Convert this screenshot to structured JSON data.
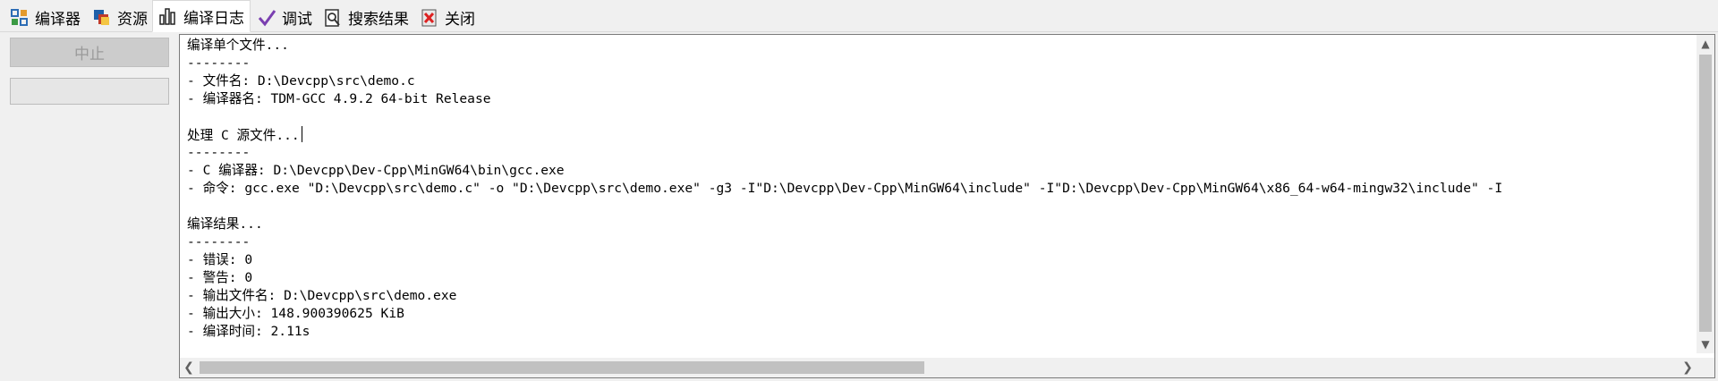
{
  "tabs": [
    {
      "label": "编译器",
      "icon": "grid-icon",
      "active": false
    },
    {
      "label": "资源",
      "icon": "resources-icon",
      "active": false
    },
    {
      "label": "编译日志",
      "icon": "bar-chart-icon",
      "active": true
    },
    {
      "label": "调试",
      "icon": "check-icon",
      "active": false
    },
    {
      "label": "搜索结果",
      "icon": "search-document-icon",
      "active": false
    },
    {
      "label": "关闭",
      "icon": "close-icon",
      "active": false
    }
  ],
  "left_panel": {
    "abort_label": "中止",
    "progress_value": 0
  },
  "log": {
    "lines": [
      "编译单个文件...",
      "--------",
      "- 文件名: D:\\Devcpp\\src\\demo.c",
      "- 编译器名: TDM-GCC 4.9.2 64-bit Release",
      "",
      "处理 C 源文件...",
      "--------",
      "- C 编译器: D:\\Devcpp\\Dev-Cpp\\MinGW64\\bin\\gcc.exe",
      "- 命令: gcc.exe \"D:\\Devcpp\\src\\demo.c\" -o \"D:\\Devcpp\\src\\demo.exe\" -g3 -I\"D:\\Devcpp\\Dev-Cpp\\MinGW64\\include\" -I\"D:\\Devcpp\\Dev-Cpp\\MinGW64\\x86_64-w64-mingw32\\include\" -I",
      "",
      "编译结果...",
      "--------",
      "- 错误: 0",
      "- 警告: 0",
      "- 输出文件名: D:\\Devcpp\\src\\demo.exe",
      "- 输出大小: 148.900390625 KiB",
      "- 编译时间: 2.11s"
    ]
  },
  "colors": {
    "background": "#f0f0f0",
    "scroll_thumb": "#c1c1c1",
    "pane_border": "#7a7a7a"
  }
}
